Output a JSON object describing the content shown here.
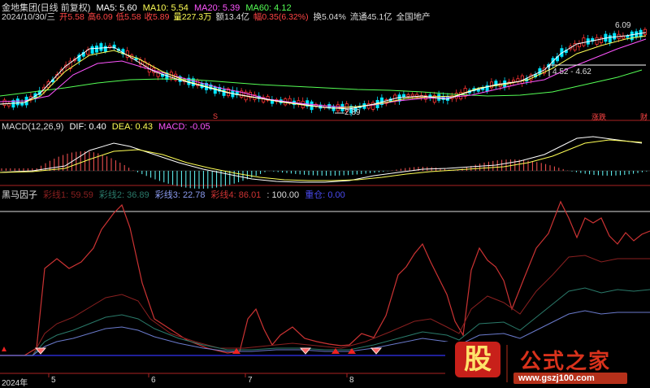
{
  "main_panel": {
    "title": "金地集团(日线 前复权)",
    "ma": [
      {
        "label": "MA5: 5.60",
        "color": "#ffffff"
      },
      {
        "label": "MA10: 5.54",
        "color": "#ffff55"
      },
      {
        "label": "MA20: 5.39",
        "color": "#ff55ff"
      },
      {
        "label": "MA60: 4.12",
        "color": "#55ff55"
      }
    ],
    "info": {
      "date": "2024/10/30/三",
      "open": "开5.58",
      "high": "高6.09",
      "low": "低5.58",
      "close": "收5.89",
      "volume": "量227.3万",
      "amount": "额13.4亿",
      "change": "幅0.35(6.32%)",
      "turnover": "换5.04%",
      "float": "流通45.1亿",
      "sector": "全国地产"
    },
    "annotations": {
      "high_label": "6.09",
      "low_label": "2.89",
      "range_label": "4.52 - 4.62",
      "mark_s": "S",
      "mark_limit": "涨跌",
      "mark_fin": "财"
    },
    "colors": {
      "up": "#ff3333",
      "down": "#00ffff",
      "ma5": "#ffffff",
      "ma10": "#ffff55",
      "ma20": "#ff55ff",
      "ma60": "#55ff55"
    }
  },
  "macd_panel": {
    "title": "MACD(12,26,9)",
    "dif": "DIF: 0.40",
    "dea": "DEA: 0.43",
    "macd": "MACD: -0.05"
  },
  "factor_panel": {
    "title": "黑马因子",
    "lines": [
      {
        "label": "彩线1: 59.59",
        "color": "#8a2020"
      },
      {
        "label": "彩线2: 36.89",
        "color": "#2a7a6a"
      },
      {
        "label": "彩线3: 22.78",
        "color": "#6a7acc"
      },
      {
        "label": "彩线4: 86.01",
        "color": "#cc3333"
      },
      {
        "label": ": 100.00",
        "color": "#dddddd"
      },
      {
        "label": "重仓: 0.00",
        "color": "#2a2acc"
      }
    ]
  },
  "time_axis": {
    "labels": [
      "2024年",
      "5",
      "6",
      "7",
      "8"
    ]
  },
  "watermark": {
    "logo_char": "股",
    "title": "公式之家",
    "url": "www.gszj100.com"
  }
}
